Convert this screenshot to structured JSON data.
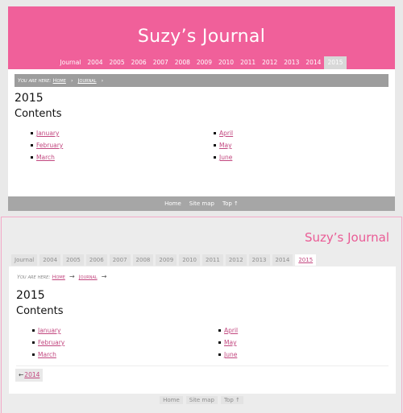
{
  "site": {
    "title": "Suzy’s Journal"
  },
  "year_nav": [
    "Journal",
    "2004",
    "2005",
    "2006",
    "2007",
    "2008",
    "2009",
    "2010",
    "2011",
    "2012",
    "2013",
    "2014",
    "2015"
  ],
  "active_year": "2015",
  "breadcrumb": {
    "prefix": "You are here:",
    "home": "Home",
    "journal": "Journal"
  },
  "page": {
    "year_heading": "2015",
    "contents_heading": "Contents"
  },
  "months": {
    "left": [
      "January",
      "February",
      "March"
    ],
    "right": [
      "April",
      "May",
      "June"
    ]
  },
  "prev": {
    "arrow": "←",
    "label": "2014"
  },
  "footer": {
    "home": "Home",
    "sitemap": "Site map",
    "top": "Top ↑"
  },
  "colors": {
    "accent": "#f0609a",
    "link": "#c2477f"
  }
}
